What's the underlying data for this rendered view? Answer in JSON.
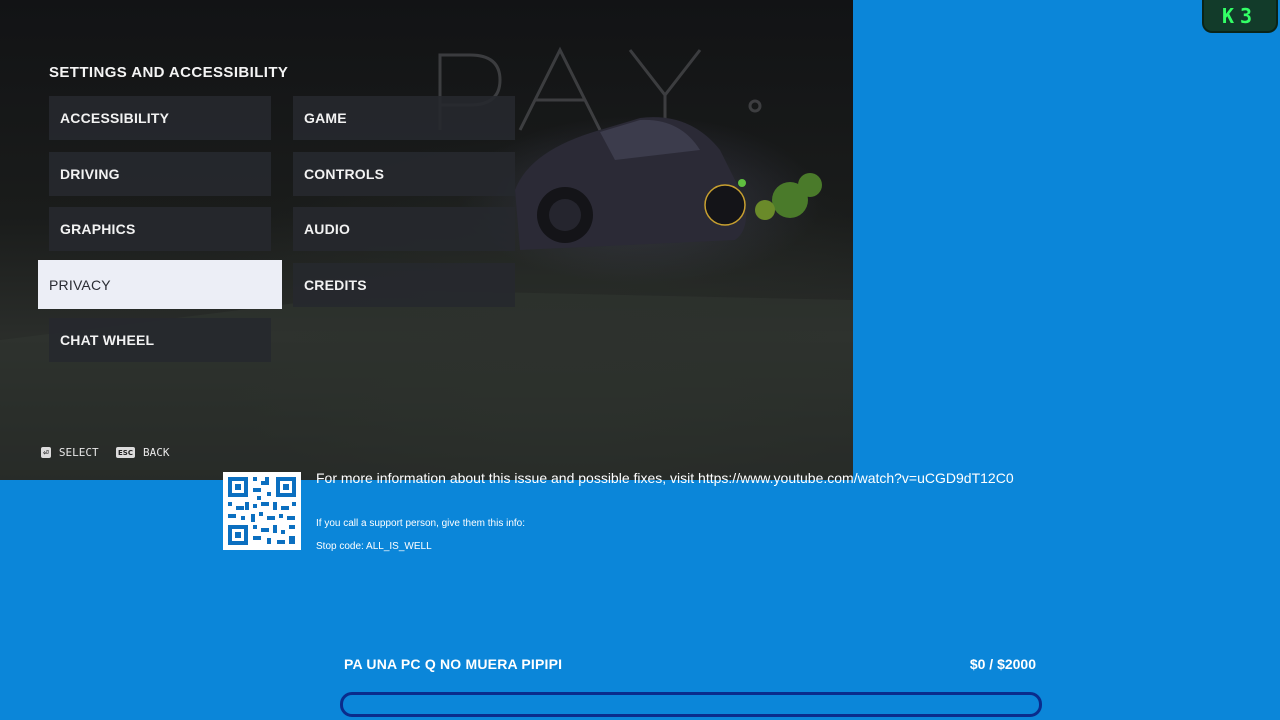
{
  "game": {
    "panel_title": "SETTINGS AND ACCESSIBILITY",
    "menu": [
      {
        "label": "ACCESSIBILITY",
        "selected": false
      },
      {
        "label": "GAME",
        "selected": false
      },
      {
        "label": "DRIVING",
        "selected": false
      },
      {
        "label": "CONTROLS",
        "selected": false
      },
      {
        "label": "GRAPHICS",
        "selected": false
      },
      {
        "label": "AUDIO",
        "selected": false
      },
      {
        "label": "PRIVACY",
        "selected": true
      },
      {
        "label": "CREDITS",
        "selected": false
      },
      {
        "label": "CHAT WHEEL",
        "selected": false
      }
    ],
    "footer": {
      "select_key": "⏎",
      "select_label": "SELECT",
      "back_key": "ESC",
      "back_label": "BACK"
    }
  },
  "overlay_logo": {
    "text": "K3",
    "color": "#33ff66"
  },
  "bsod": {
    "info_line": "For more information about this issue and possible fixes, visit https://www.youtube.com/watch?v=uCGD9dT12C0",
    "support_line": "If you call a support person, give them this info:",
    "stop_code": "Stop code: ALL_IS_WELL",
    "background_color": "#0b86d9"
  },
  "donation": {
    "label": "PA UNA PC Q NO MUERA PIPIPI",
    "amount": "$0 / $2000",
    "progress": 0
  }
}
